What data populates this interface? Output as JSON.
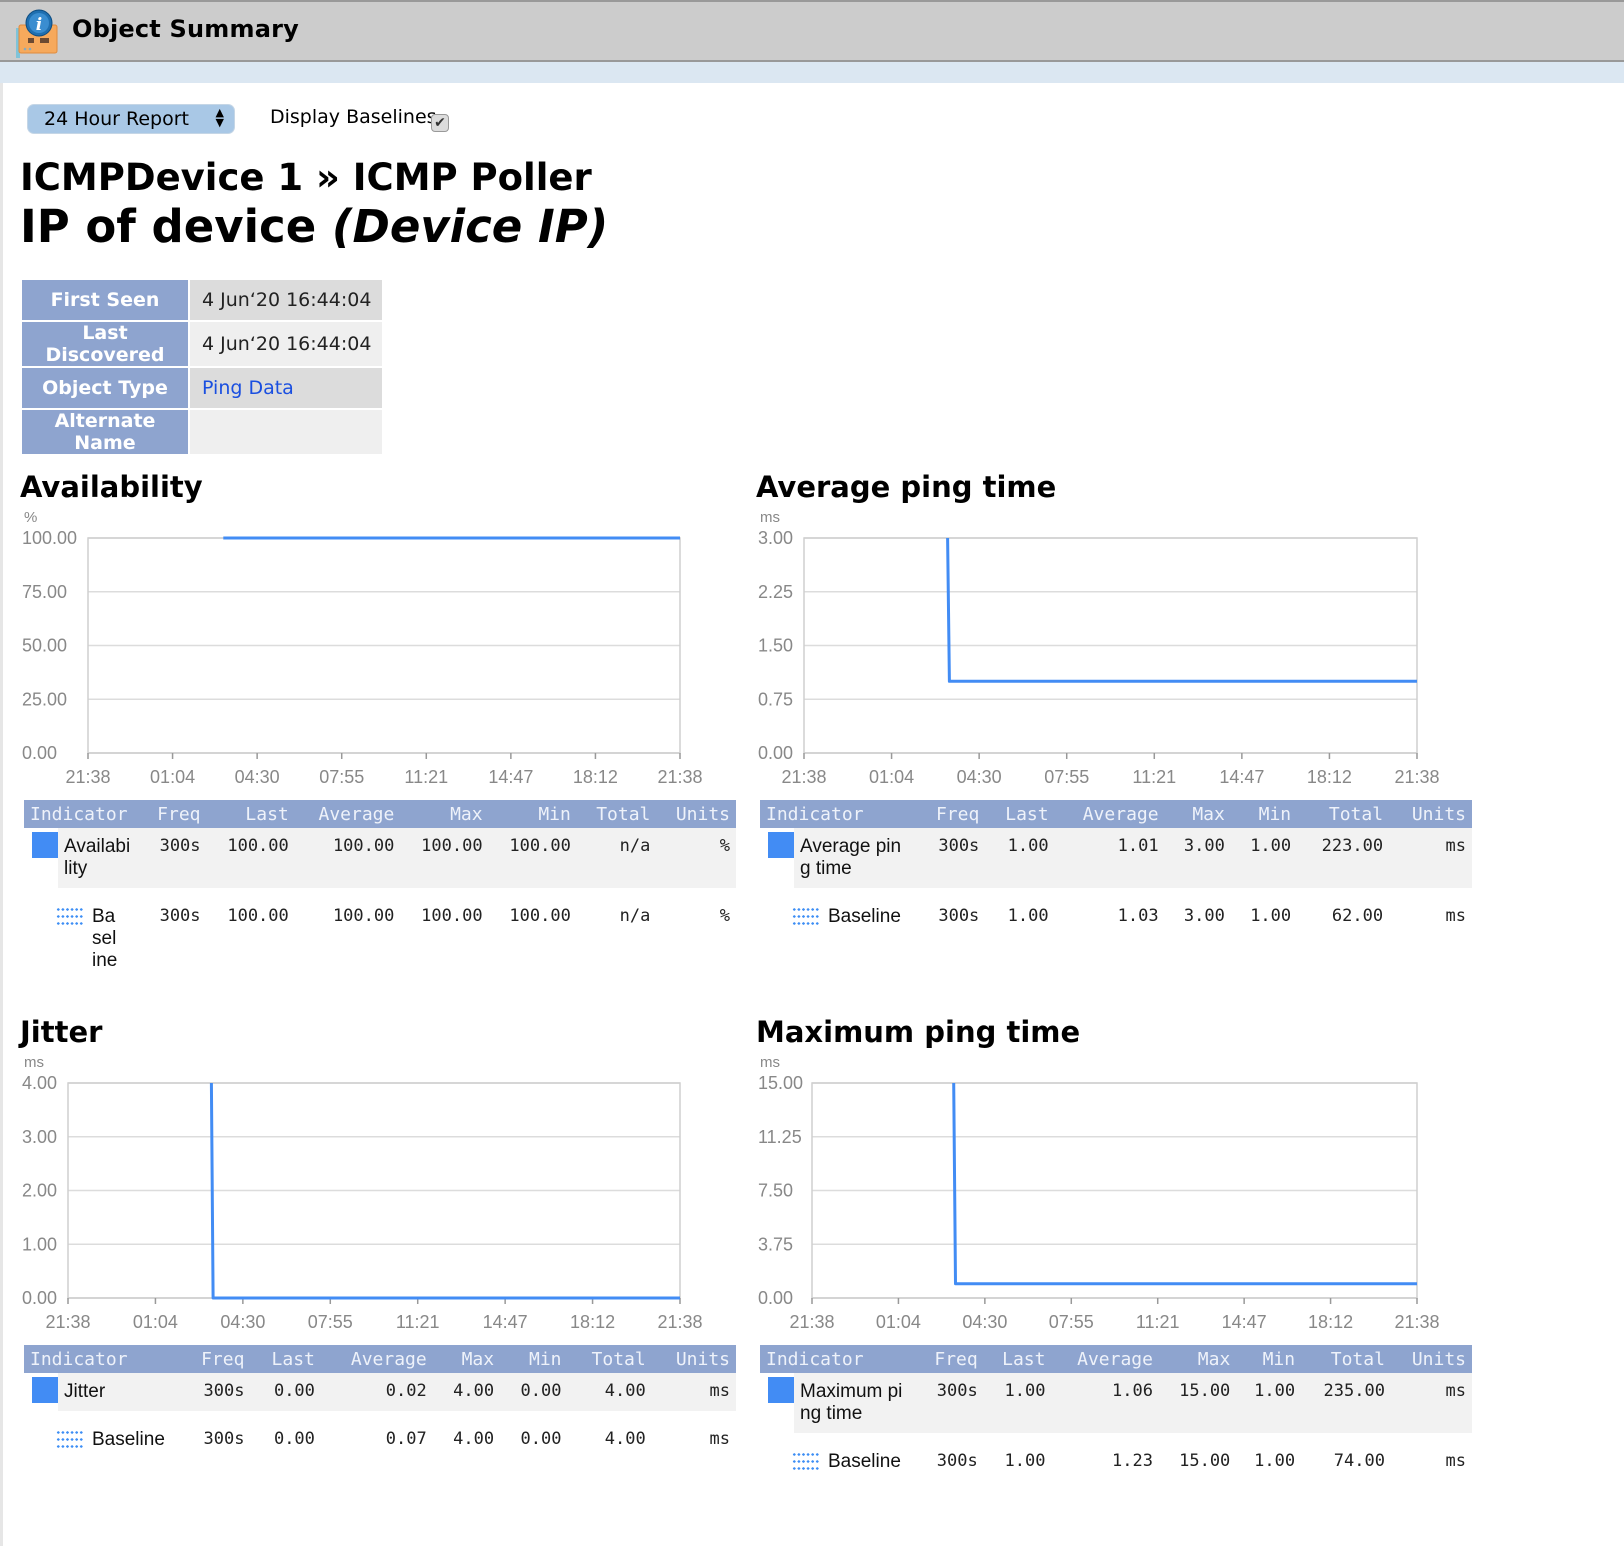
{
  "window": {
    "title": "Object Summary",
    "icon": "object-info-icon"
  },
  "controls": {
    "report_select": {
      "value": "24 Hour Report",
      "icon": "updown-arrows-icon"
    },
    "display_baselines": {
      "label": "Display Baselines",
      "checked": true,
      "check_glyph": "✔"
    }
  },
  "header": {
    "breadcrumb": "ICMPDevice 1 » ICMP Poller",
    "subtitle_main": "IP of device ",
    "subtitle_italic": "(Device IP)"
  },
  "properties": [
    {
      "label": "First Seen",
      "value": "4 Jun‘20 16:44:04"
    },
    {
      "label": "Last Discovered",
      "value": "4 Jun‘20 16:44:04"
    },
    {
      "label": "Object Type",
      "value": "Ping Data",
      "link": true
    },
    {
      "label": "Alternate Name",
      "value": ""
    }
  ],
  "colors": {
    "series": "#428cf4",
    "header_blue": "#8ea4cf",
    "grid": "#d9d9d9"
  },
  "stats_headers": [
    "Indicator",
    "Freq",
    "Last",
    "Average",
    "Max",
    "Min",
    "Total",
    "Units"
  ],
  "chart_data": [
    {
      "type": "line",
      "title": "Availability",
      "ylabel": "%",
      "ylim": [
        0,
        100
      ],
      "yticks": [
        "0.00",
        "25.00",
        "50.00",
        "75.00",
        "100.00"
      ],
      "x": [
        "21:38",
        "01:04",
        "04:30",
        "07:55",
        "11:21",
        "14:47",
        "18:12",
        "21:38"
      ],
      "series": [
        {
          "name": "Availability",
          "points": [
            [
              1.6,
              100
            ],
            [
              7.0,
              100
            ]
          ]
        }
      ],
      "stats": [
        {
          "name": "Availability",
          "kind": "series",
          "freq": "300s",
          "last": "100.00",
          "average": "100.00",
          "max": "100.00",
          "min": "100.00",
          "total": "n/a",
          "units": "%"
        },
        {
          "name": "Baseline",
          "kind": "baseline",
          "freq": "300s",
          "last": "100.00",
          "average": "100.00",
          "max": "100.00",
          "min": "100.00",
          "total": "n/a",
          "units": "%"
        }
      ]
    },
    {
      "type": "line",
      "title": "Average ping time",
      "ylabel": "ms",
      "ylim": [
        0,
        3
      ],
      "yticks": [
        "0.00",
        "0.75",
        "1.50",
        "2.25",
        "3.00"
      ],
      "x": [
        "21:38",
        "01:04",
        "04:30",
        "07:55",
        "11:21",
        "14:47",
        "18:12",
        "21:38"
      ],
      "series": [
        {
          "name": "Average ping time",
          "points": [
            [
              1.64,
              3.0
            ],
            [
              1.66,
              1.0
            ],
            [
              7.0,
              1.0
            ]
          ]
        }
      ],
      "stats": [
        {
          "name": "Average ping time",
          "kind": "series",
          "freq": "300s",
          "last": "1.00",
          "average": "1.01",
          "max": "3.00",
          "min": "1.00",
          "total": "223.00",
          "units": "ms"
        },
        {
          "name": "Baseline",
          "kind": "baseline",
          "freq": "300s",
          "last": "1.00",
          "average": "1.03",
          "max": "3.00",
          "min": "1.00",
          "total": "62.00",
          "units": "ms"
        }
      ]
    },
    {
      "type": "line",
      "title": "Jitter",
      "ylabel": "ms",
      "ylim": [
        0,
        4
      ],
      "yticks": [
        "0.00",
        "1.00",
        "2.00",
        "3.00",
        "4.00"
      ],
      "x": [
        "21:38",
        "01:04",
        "04:30",
        "07:55",
        "11:21",
        "14:47",
        "18:12",
        "21:38"
      ],
      "series": [
        {
          "name": "Jitter",
          "points": [
            [
              1.64,
              4.0
            ],
            [
              1.66,
              0.0
            ],
            [
              7.0,
              0.0
            ]
          ]
        }
      ],
      "stats": [
        {
          "name": "Jitter",
          "kind": "series",
          "freq": "300s",
          "last": "0.00",
          "average": "0.02",
          "max": "4.00",
          "min": "0.00",
          "total": "4.00",
          "units": "ms"
        },
        {
          "name": "Baseline",
          "kind": "baseline",
          "freq": "300s",
          "last": "0.00",
          "average": "0.07",
          "max": "4.00",
          "min": "0.00",
          "total": "4.00",
          "units": "ms"
        }
      ]
    },
    {
      "type": "line",
      "title": "Maximum ping time",
      "ylabel": "ms",
      "ylim": [
        0,
        15
      ],
      "yticks": [
        "0.00",
        "3.75",
        "7.50",
        "11.25",
        "15.00"
      ],
      "x": [
        "21:38",
        "01:04",
        "04:30",
        "07:55",
        "11:21",
        "14:47",
        "18:12",
        "21:38"
      ],
      "series": [
        {
          "name": "Maximum ping time",
          "points": [
            [
              1.64,
              15.0
            ],
            [
              1.66,
              1.0
            ],
            [
              7.0,
              1.0
            ]
          ]
        }
      ],
      "stats": [
        {
          "name": "Maximum ping time",
          "kind": "series",
          "freq": "300s",
          "last": "1.00",
          "average": "1.06",
          "max": "15.00",
          "min": "1.00",
          "total": "235.00",
          "units": "ms"
        },
        {
          "name": "Baseline",
          "kind": "baseline",
          "freq": "300s",
          "last": "1.00",
          "average": "1.23",
          "max": "15.00",
          "min": "1.00",
          "total": "74.00",
          "units": "ms"
        }
      ]
    }
  ]
}
